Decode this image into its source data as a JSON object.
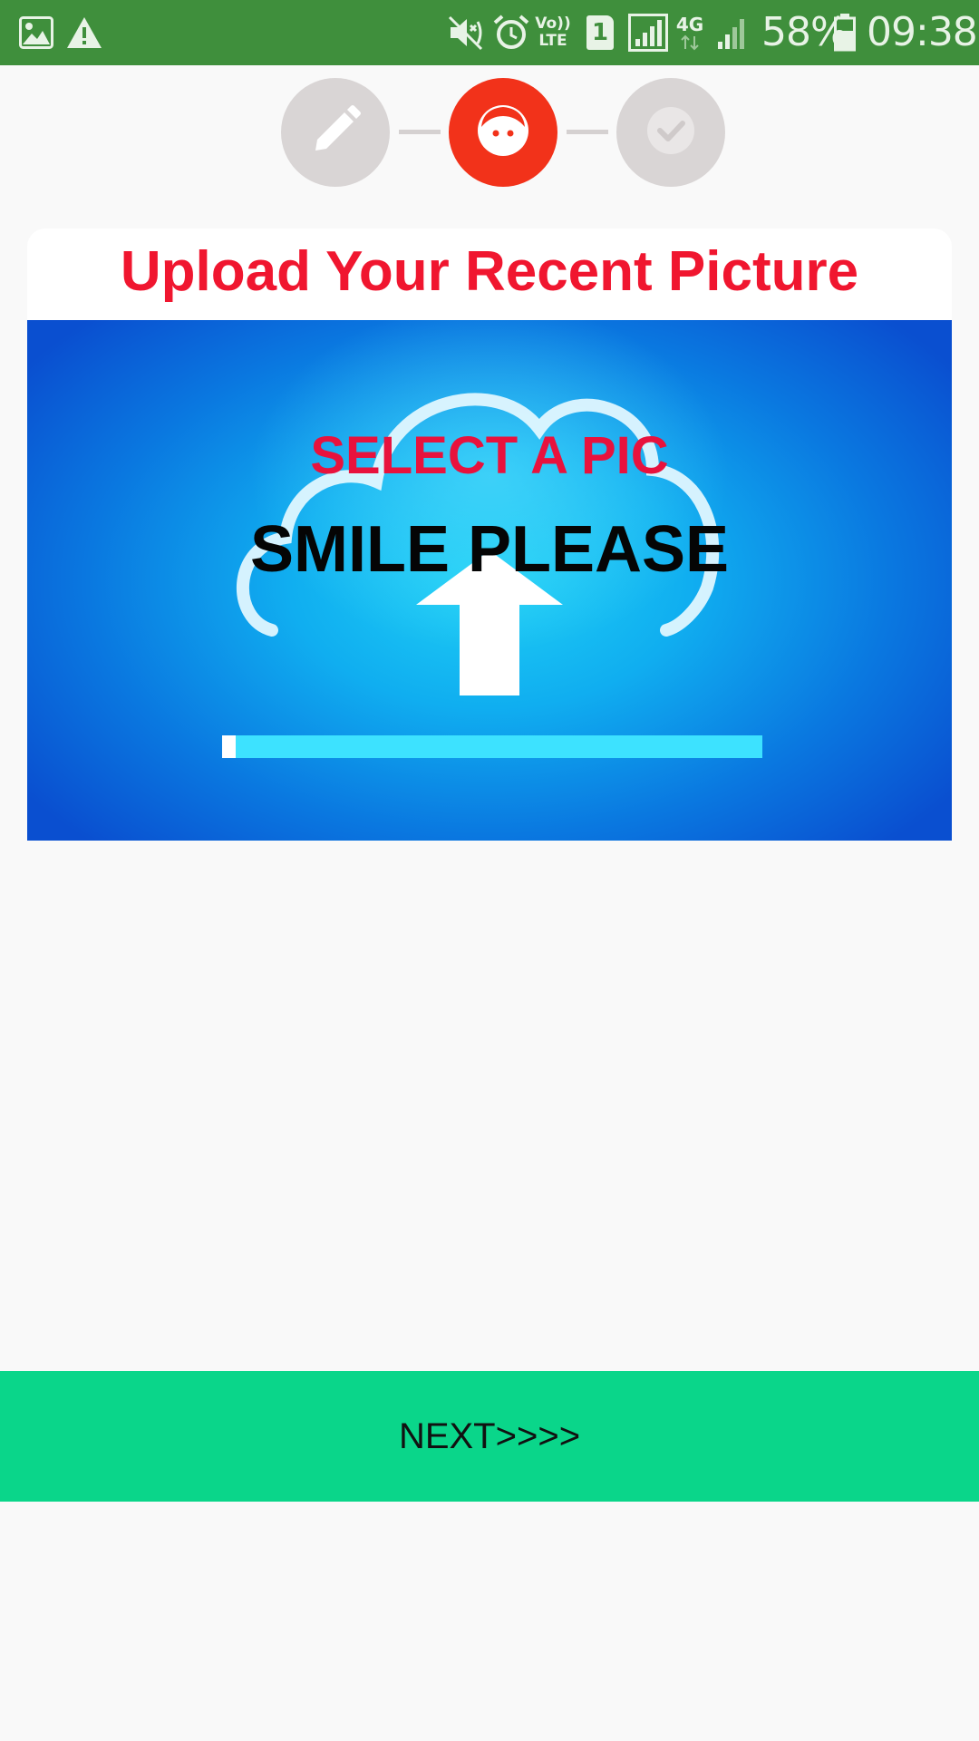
{
  "status_bar": {
    "battery_percent": "58%",
    "time": "09:38",
    "network_type": "4G",
    "volte_label": "Vo)) LTE",
    "sim_slot": "1",
    "background_color": "#3f8f3c",
    "left_icons": [
      "image-icon",
      "warning-icon"
    ],
    "right_icons": [
      "vibrate-mute-icon",
      "alarm-icon",
      "volte-icon",
      "sim-1-icon",
      "signal-icon",
      "4g-data-icon",
      "signal-weak-icon",
      "battery-icon"
    ]
  },
  "stepper": {
    "steps": [
      {
        "icon": "pencil-icon",
        "state": "inactive",
        "color": "#d9d5d5"
      },
      {
        "icon": "face-icon",
        "state": "active",
        "color": "#f2321a"
      },
      {
        "icon": "check-icon",
        "state": "inactive",
        "color": "#d9d5d5"
      }
    ]
  },
  "card": {
    "title": "Upload Your Recent Picture",
    "title_color": "#f0162f",
    "upload_image": {
      "heading": "SELECT A PIC",
      "subheading": "SMILE PLEASE",
      "icon": "cloud-upload-icon"
    }
  },
  "next_button": {
    "label": "NEXT>>>>",
    "color": "#0ad68a"
  }
}
